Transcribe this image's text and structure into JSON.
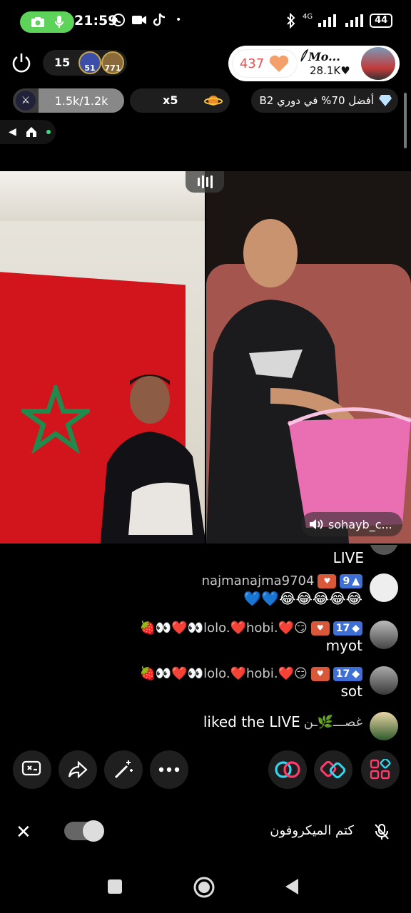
{
  "status_bar": {
    "time": "21:59",
    "battery": "44",
    "network": "4G"
  },
  "top": {
    "viewer_count": "15",
    "viewer_avatars": [
      {
        "badge": "51",
        "color": "#3b4fa8"
      },
      {
        "badge": "771",
        "color": "#8a6a3a"
      }
    ],
    "host_score": "437",
    "host_name": "Mo...",
    "host_likes": "28.1K"
  },
  "stats": {
    "score": "1.5k/1.2k",
    "multiplier": "x5",
    "rank_text": "أفضل 70% في دوري B2"
  },
  "guest_name": "sohayb_c...",
  "chat": {
    "partial_line": "LIVE",
    "messages": [
      {
        "user": "najmanajma9704",
        "level": "9",
        "text": "💙💙😂😂😂😂😂"
      },
      {
        "user": "🍓👀❤️👀lolo.❤️hobi.❤️😏",
        "level": "17",
        "text": "myot"
      },
      {
        "user": "🍓👀❤️👀lolo.❤️hobi.❤️😏",
        "level": "17",
        "text": "sot"
      }
    ],
    "join": {
      "user": "غصـــ🌿ـن",
      "text": "liked the LIVE"
    }
  },
  "mic_bar": {
    "mute_label": "كتم الميكروفون"
  },
  "icons": {
    "actions_left": [
      "caption-icon",
      "share-icon",
      "magic-wand-icon",
      "more-icon"
    ],
    "actions_right": [
      "link-icon",
      "effects-icon",
      "apps-icon"
    ]
  },
  "colors": {
    "accent_pink": "#ff3b6b",
    "accent_cyan": "#33d6f0",
    "flag_red": "#d2151d",
    "flag_green": "#1f8a4c"
  }
}
